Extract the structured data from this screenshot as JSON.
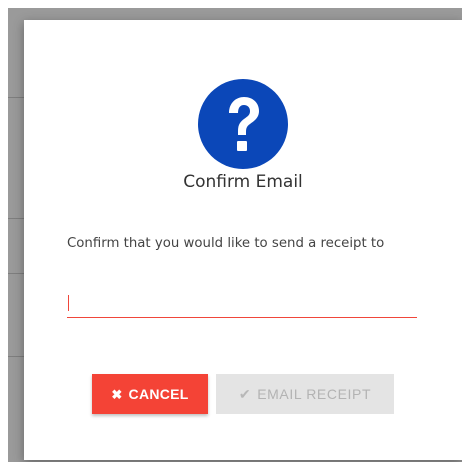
{
  "dialog": {
    "title": "Confirm Email",
    "message": "Confirm that you would like to send a receipt to",
    "icon": "question-circle-icon",
    "accent_color": "#0b47b8"
  },
  "email_input": {
    "value": "",
    "placeholder": "",
    "underline_color": "#f0463a"
  },
  "buttons": {
    "cancel_label": "CANCEL",
    "cancel_icon": "close-icon",
    "cancel_color": "#f44336",
    "send_label": "EMAIL RECEIPT",
    "send_icon": "check-icon",
    "send_state": "disabled"
  }
}
